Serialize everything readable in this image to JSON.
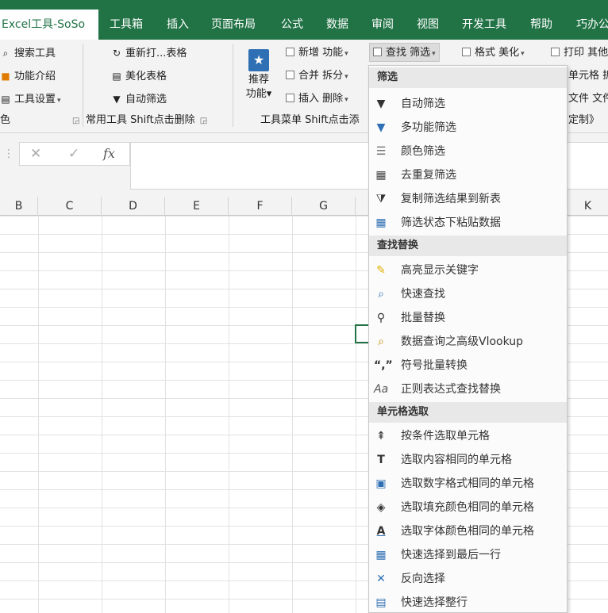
{
  "tabs": [
    {
      "label": "Excel工具-SoSo",
      "active": true
    },
    {
      "label": "工具箱"
    },
    {
      "label": "插入"
    },
    {
      "label": "页面布局"
    },
    {
      "label": "公式"
    },
    {
      "label": "数据"
    },
    {
      "label": "审阅"
    },
    {
      "label": "视图"
    },
    {
      "label": "开发工具"
    },
    {
      "label": "帮助"
    },
    {
      "label": "巧办公"
    }
  ],
  "ribbon": {
    "group1": {
      "items": [
        {
          "label": "搜索工具",
          "icon": "search-icon"
        },
        {
          "label": "功能介绍",
          "icon": "orange-square-icon"
        },
        {
          "label": "工具设置",
          "icon": "settings-icon"
        }
      ],
      "label": "色"
    },
    "group2": {
      "items": [
        {
          "label": "重新打...表格",
          "icon": "refresh-icon"
        },
        {
          "label": "美化表格",
          "icon": "table-icon"
        },
        {
          "label": "自动筛选",
          "icon": "filter-icon"
        }
      ],
      "label": "常用工具 Shift点击删除"
    },
    "big_button": {
      "label1": "推荐",
      "label2": "功能"
    },
    "group3": {
      "items": [
        {
          "label": "新增 功能"
        },
        {
          "label": "合并 拆分"
        },
        {
          "label": "插入 删除"
        }
      ],
      "label": "工具菜单 Shift点击添"
    },
    "menus_row": [
      {
        "label": "查找 筛选"
      },
      {
        "label": "格式 美化"
      },
      {
        "label": "打印 其他"
      }
    ],
    "right_items": [
      {
        "label": "单元格 拆"
      },
      {
        "label": "文件 文件"
      },
      {
        "label": "定制》"
      }
    ]
  },
  "formula_bar": {
    "cancel": "✕",
    "enter": "✓",
    "fx": "fx",
    "dots": "⋮"
  },
  "columns": [
    "B",
    "C",
    "D",
    "E",
    "F",
    "G",
    "K"
  ],
  "menu": {
    "sections": [
      {
        "header": "筛选",
        "items": [
          {
            "label": "自动筛选",
            "icon": "funnel-icon"
          },
          {
            "label": "多功能筛选",
            "icon": "multi-filter-icon"
          },
          {
            "label": "颜色筛选",
            "icon": "color-filter-icon"
          },
          {
            "label": "去重复筛选",
            "icon": "dedupe-filter-icon"
          },
          {
            "label": "复制筛选结果到新表",
            "icon": "copy-filter-icon"
          },
          {
            "label": "筛选状态下粘贴数据",
            "icon": "paste-grid-icon"
          }
        ]
      },
      {
        "header": "查找替换",
        "items": [
          {
            "label": "高亮显示关键字",
            "icon": "highlighter-icon"
          },
          {
            "label": "快速查找",
            "icon": "quick-find-icon"
          },
          {
            "label": "批量替换",
            "icon": "binoculars-icon"
          },
          {
            "label": "数据查询之高级Vlookup",
            "icon": "magnifier-doc-icon"
          },
          {
            "label": "符号批量转换",
            "icon": "quote-symbols-icon"
          },
          {
            "label": "正则表达式查找替换",
            "icon": "regex-icon"
          }
        ]
      },
      {
        "header": "单元格选取",
        "items": [
          {
            "label": "按条件选取单元格",
            "icon": "condition-select-icon"
          },
          {
            "label": "选取内容相同的单元格",
            "icon": "same-content-icon"
          },
          {
            "label": "选取数字格式相同的单元格",
            "icon": "number-format-icon"
          },
          {
            "label": "选取填充颜色相同的单元格",
            "icon": "fill-bucket-icon"
          },
          {
            "label": "选取字体颜色相同的单元格",
            "icon": "font-color-icon"
          },
          {
            "label": "快速选择到最后一行",
            "icon": "last-row-icon"
          },
          {
            "label": "反向选择",
            "icon": "inverse-select-icon"
          },
          {
            "label": "快速选择整行",
            "icon": "whole-row-icon"
          }
        ]
      }
    ]
  },
  "colors": {
    "accent": "#217346",
    "icon_dark": "#333333",
    "icon_blue": "#2f6fb3"
  }
}
